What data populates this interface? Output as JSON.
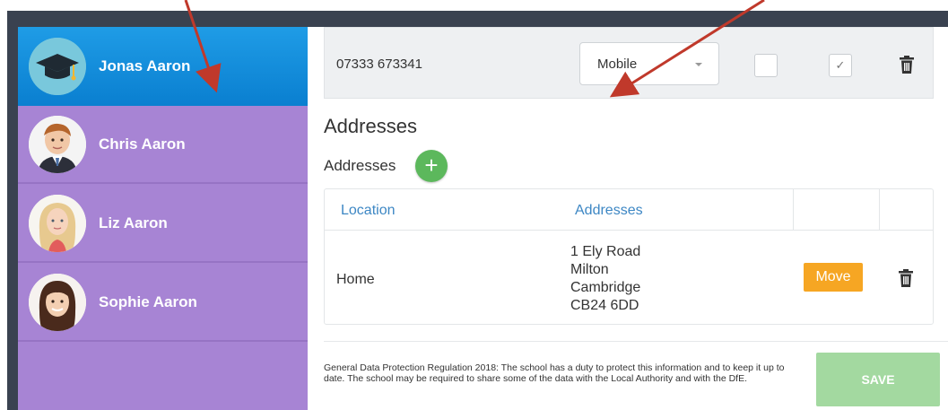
{
  "sidebar": {
    "students": [
      {
        "name": "Jonas Aaron",
        "avatar": "graduation-cap-avatar",
        "active": true
      },
      {
        "name": "Chris Aaron",
        "avatar": "boy-photo",
        "active": false
      },
      {
        "name": "Liz Aaron",
        "avatar": "girl-blonde-photo",
        "active": false
      },
      {
        "name": "Sophie Aaron",
        "avatar": "girl-dark-hair-photo",
        "active": false
      }
    ]
  },
  "phone": {
    "number": "07333 673341",
    "type": "Mobile",
    "checkbox_1_checked": false,
    "checkbox_2_checked": true,
    "check_glyph": "✓"
  },
  "addresses": {
    "heading": "Addresses",
    "subheading": "Addresses",
    "add_label": "+",
    "columns": [
      "Location",
      "Addresses"
    ],
    "rows": [
      {
        "location": "Home",
        "address_lines": [
          "1 Ely Road",
          "Milton",
          "Cambridge",
          "CB24 6DD"
        ],
        "move_label": "Move"
      }
    ]
  },
  "footer": {
    "gdpr_text": "General Data Protection Regulation 2018: The school has a duty to protect this information and to keep it up to date. The school may be required to share some of the data with the Local Authority and with the DfE.",
    "save_label": "SAVE"
  },
  "colors": {
    "sidebar": "#a784d4",
    "active_student": "#0a7fd0",
    "add_button": "#5cb85c",
    "move_button": "#f6a623",
    "save_button": "#a3d9a0",
    "link_blue": "#3d87c4",
    "annotation_arrow": "#c0392b"
  },
  "icons": {
    "trash": "trash-icon",
    "caret": "chevron-down-icon",
    "add": "plus-icon"
  }
}
